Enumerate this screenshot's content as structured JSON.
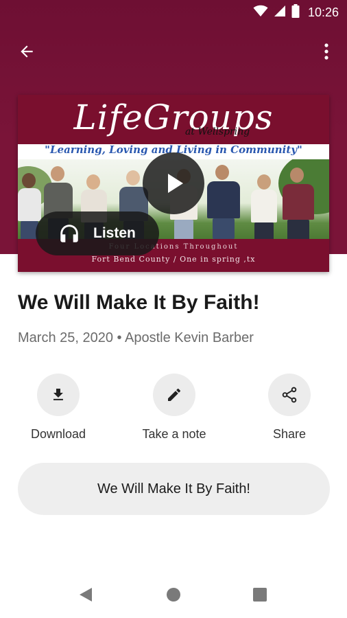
{
  "status_bar": {
    "time": "10:26",
    "icons": [
      "wifi-icon",
      "signal-icon",
      "battery-icon"
    ]
  },
  "app_bar": {
    "back_icon": "arrow-left-icon",
    "menu_icon": "more-vertical-icon"
  },
  "artwork": {
    "title": "LifeGroups",
    "subtitle": "at Wellspring",
    "tagline": "\"Learning, Loving and Living in Community\"",
    "footer_line1": "Four Locations Throughout",
    "footer_line2": "Fort Bend County / One in spring ,tx"
  },
  "player": {
    "play_icon": "play-icon",
    "listen_label": "Listen",
    "listen_icon": "headphones-icon"
  },
  "sermon": {
    "title": "We Will Make It By Faith!",
    "meta": "March 25, 2020 • Apostle Kevin Barber"
  },
  "actions": [
    {
      "label": "Download",
      "icon": "download-icon"
    },
    {
      "label": "Take a note",
      "icon": "pencil-icon"
    },
    {
      "label": "Share",
      "icon": "share-icon"
    }
  ],
  "series_button": {
    "label": "We Will Make It By Faith!"
  },
  "nav_bar": {
    "back": "nav-back-icon",
    "home": "nav-home-icon",
    "recents": "nav-recents-icon"
  },
  "colors": {
    "brand_maroon": "#7a1438",
    "pill_gray": "#eeeeee",
    "tagline_blue": "#2a58b0"
  }
}
